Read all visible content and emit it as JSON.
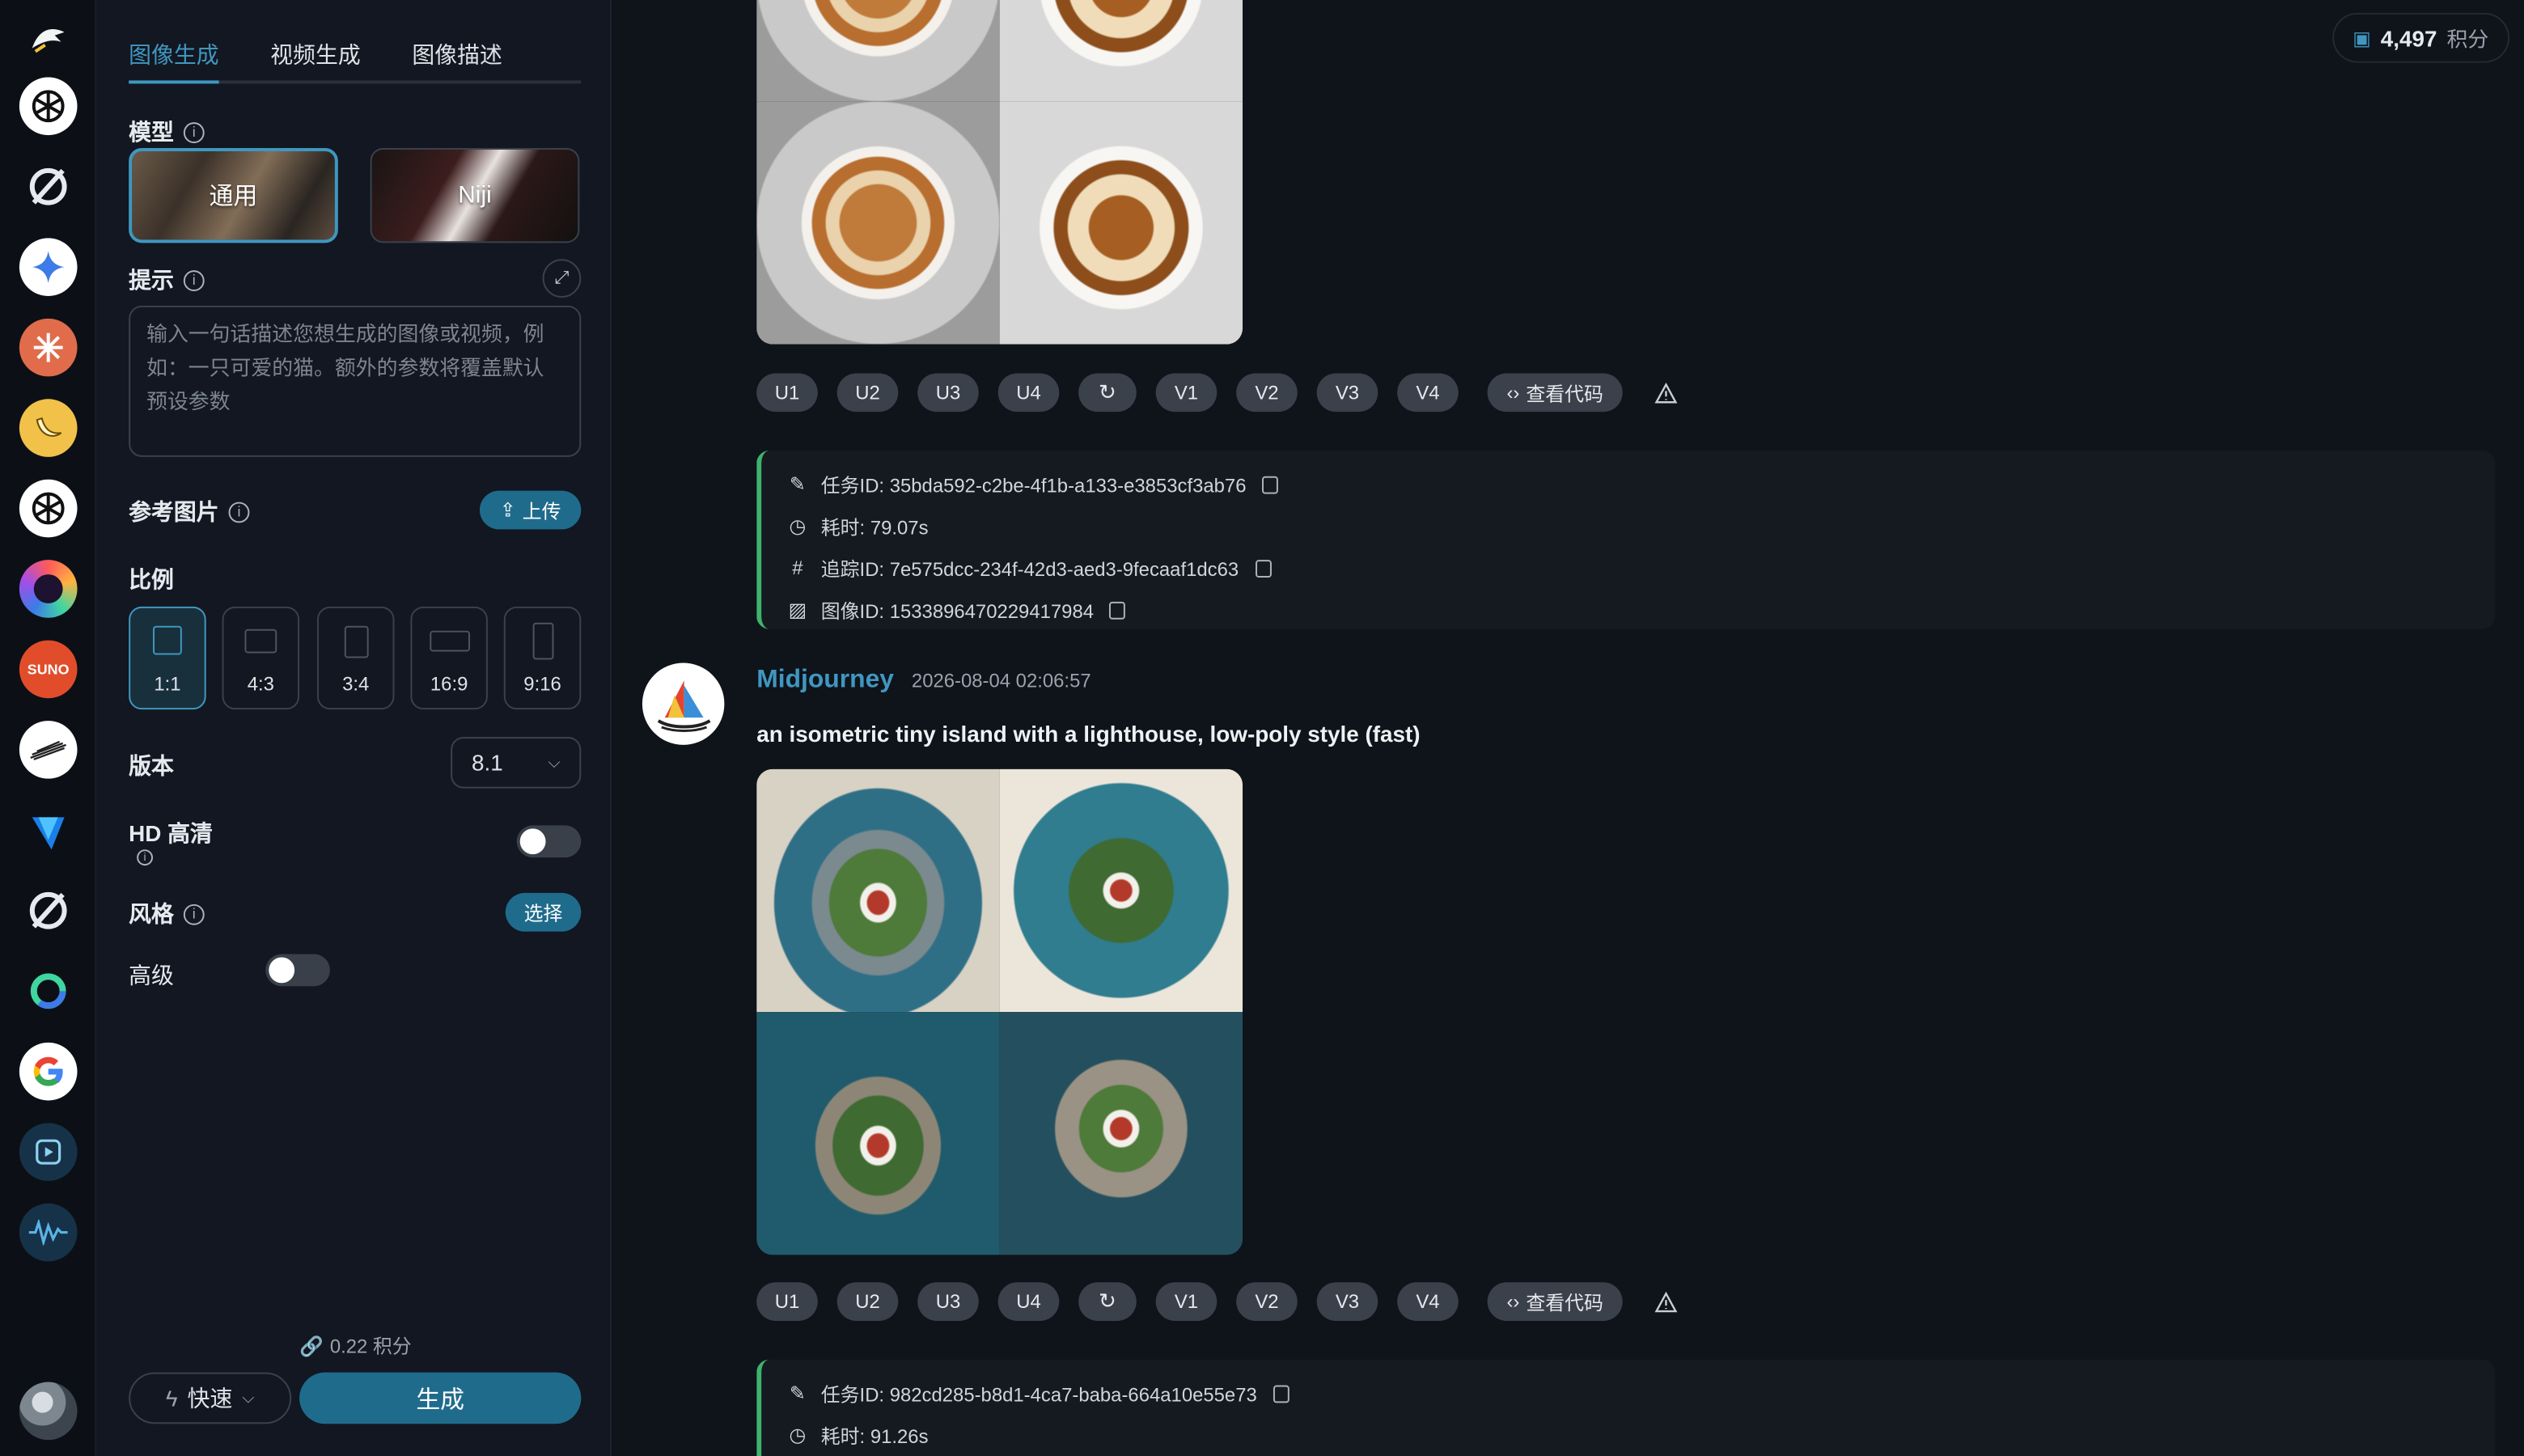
{
  "sidebar_apps": [
    {
      "name": "openai-icon",
      "color": "#ffffff"
    },
    {
      "name": "perplexity-icon",
      "color": "#111418"
    },
    {
      "name": "gemini-icon",
      "color": "#ffffff"
    },
    {
      "name": "claude-icon",
      "color": "#e06c4b"
    },
    {
      "name": "banana-icon",
      "color": "#f2c14a"
    },
    {
      "name": "openai-icon",
      "color": "#ffffff"
    },
    {
      "name": "copilot-icon",
      "color": "#6a3fd8"
    },
    {
      "name": "suno-icon",
      "color": "#e14d2a",
      "label": "SUNO"
    },
    {
      "name": "midjourney-icon",
      "color": "#ffffff"
    },
    {
      "name": "vidu-icon",
      "color": "#1a7fe8"
    },
    {
      "name": "perplexity-icon",
      "color": "#111418"
    },
    {
      "name": "kling-icon",
      "color": "#111418"
    },
    {
      "name": "google-icon",
      "color": "#ffffff"
    },
    {
      "name": "video-player-icon",
      "color": "#163249"
    },
    {
      "name": "audio-wave-icon",
      "color": "#163249"
    }
  ],
  "panel": {
    "tabs": [
      "图像生成",
      "视频生成",
      "图像描述"
    ],
    "model_label": "模型",
    "models": [
      "通用",
      "Niji"
    ],
    "prompt_label": "提示",
    "prompt_placeholder": "输入一句话描述您想生成的图像或视频，例如：一只可爱的猫。额外的参数将覆盖默认预设参数",
    "reference_label": "参考图片",
    "upload_label": "上传",
    "ratio_label": "比例",
    "ratios": [
      "1:1",
      "4:3",
      "3:4",
      "16:9",
      "9:16"
    ],
    "version_label": "版本",
    "version_value": "8.1",
    "hd_label": "HD 高清",
    "style_label": "风格",
    "style_button": "选择",
    "advanced_label": "高级",
    "cost": "0.22 积分",
    "speed": "快速",
    "generate": "生成"
  },
  "header": {
    "credits_value": "4,497",
    "credits_unit": "积分"
  },
  "feed": {
    "job1": {
      "actions": [
        "U1",
        "U2",
        "U3",
        "U4",
        "V1",
        "V2",
        "V3",
        "V4"
      ],
      "view_code": "查看代码",
      "task_id": "任务ID: 35bda592-c2be-4f1b-a133-e3853cf3ab76",
      "duration": "耗时: 79.07s",
      "trace_id": "追踪ID: 7e575dcc-234f-42d3-aed3-9fecaaf1dc63",
      "image_id": "图像ID: 1533896470229417984"
    },
    "job2": {
      "author": "Midjourney",
      "timestamp": "2026-08-04 02:06:57",
      "prompt": "an isometric tiny island with a lighthouse, low-poly style (fast)",
      "actions": [
        "U1",
        "U2",
        "U3",
        "U4",
        "V1",
        "V2",
        "V3",
        "V4"
      ],
      "view_code": "查看代码",
      "task_id": "任务ID: 982cd285-b8d1-4ca7-baba-664a10e55e73",
      "duration": "耗时: 91.26s"
    }
  }
}
